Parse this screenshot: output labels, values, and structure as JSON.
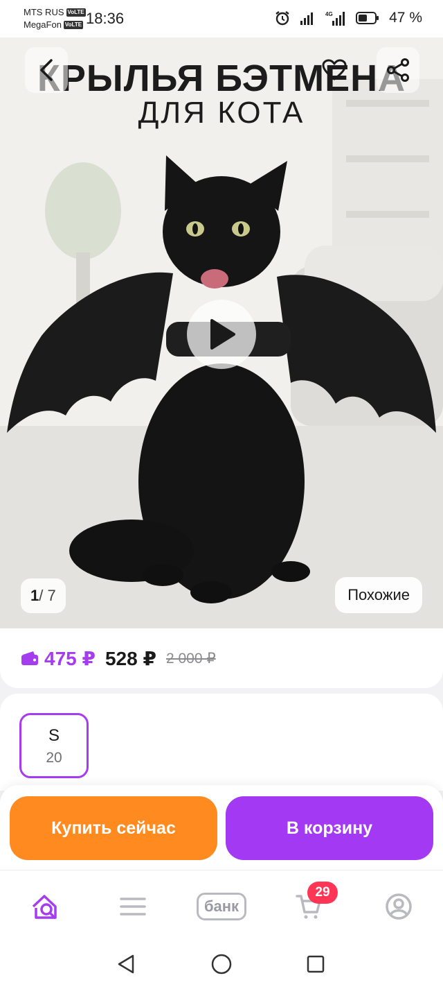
{
  "status_bar": {
    "carrier1": "MTS RUS",
    "carrier2": "MegaFon",
    "volte": "VoLTE",
    "time": "18:36",
    "battery": "47 %",
    "network": "4G"
  },
  "hero": {
    "title_line1": "КРЫЛЬЯ БЭТМЕНА",
    "title_line2": "ДЛЯ КОТА",
    "counter_current": "1",
    "counter_total": "/ 7",
    "similar_label": "Похожие"
  },
  "price": {
    "wallet_price": "475 ₽",
    "price": "528 ₽",
    "old_price": "2 000 ₽",
    "accent_color": "#a63cf0"
  },
  "size": {
    "name": "S",
    "count": "20"
  },
  "actions": {
    "buy_now": "Купить сейчас",
    "add_to_cart": "В корзину",
    "buy_color": "#ff8a1f",
    "cart_color": "#a339f2"
  },
  "bottom_nav": {
    "bank_label": "банк",
    "cart_badge": "29",
    "items": [
      "home-search-icon",
      "catalog-menu-icon",
      "bank-icon",
      "cart-icon",
      "profile-icon"
    ]
  },
  "system_nav": [
    "back-triangle-icon",
    "home-circle-icon",
    "recent-square-icon"
  ]
}
